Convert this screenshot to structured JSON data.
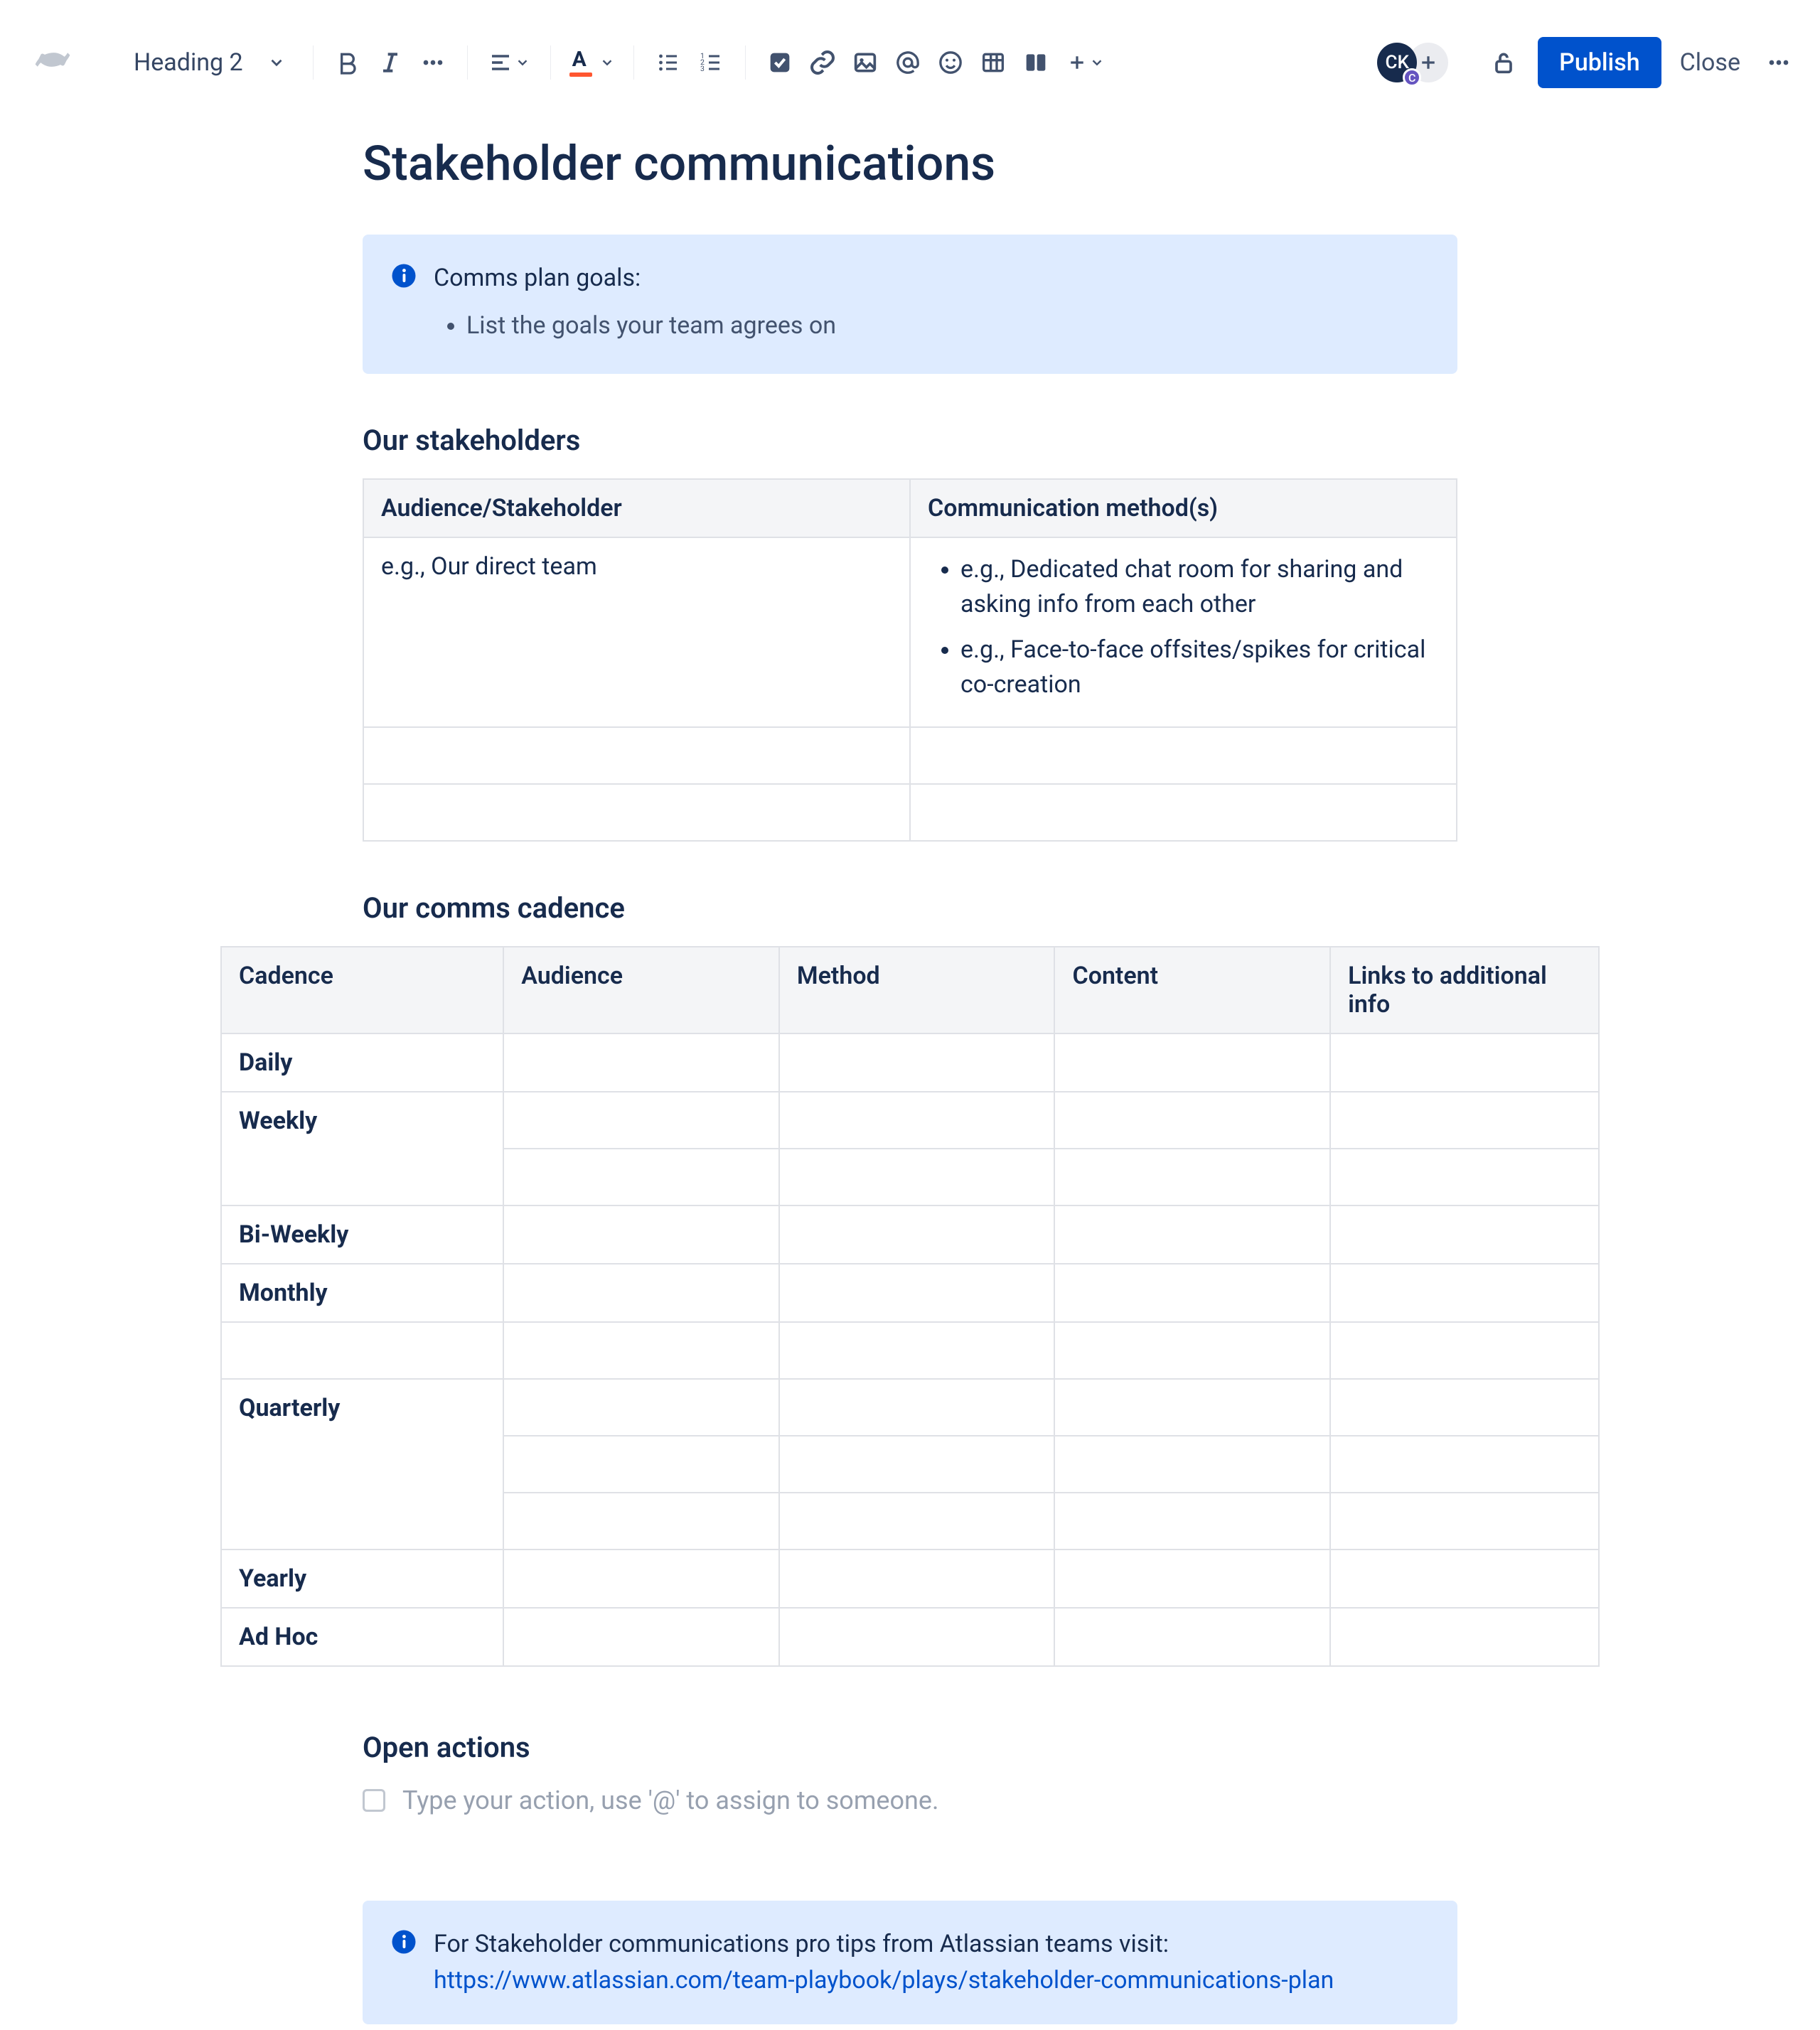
{
  "toolbar": {
    "text_style": "Heading 2",
    "publish_label": "Publish",
    "close_label": "Close",
    "avatar_initials": "CK",
    "avatar_presence": "C"
  },
  "page": {
    "title": "Stakeholder communications"
  },
  "goals_panel": {
    "lead": "Comms plan goals:",
    "items": [
      "List the goals your team agrees on"
    ]
  },
  "stakeholders": {
    "heading": "Our stakeholders",
    "headers": [
      "Audience/Stakeholder",
      "Communication method(s)"
    ],
    "row1_audience": "e.g., Our direct team",
    "row1_methods": [
      "e.g., Dedicated chat room for sharing and asking info from each other",
      "e.g., Face-to-face offsites/spikes for critical co-creation"
    ]
  },
  "cadence": {
    "heading": "Our comms cadence",
    "headers": [
      "Cadence",
      "Audience",
      "Method",
      "Content",
      "Links to additional info"
    ],
    "labels": {
      "daily": "Daily",
      "weekly": "Weekly",
      "biweekly": "Bi-Weekly",
      "monthly": "Monthly",
      "quarterly": "Quarterly",
      "yearly": "Yearly",
      "adhoc": "Ad Hoc"
    }
  },
  "open_actions": {
    "heading": "Open actions",
    "placeholder": "Type your action, use '@' to assign to someone."
  },
  "tips_panel": {
    "lead": "For Stakeholder communications pro tips from Atlassian teams visit: ",
    "link_text": "https://www.atlassian.com/team-playbook/plays/stakeholder-communications-plan"
  }
}
